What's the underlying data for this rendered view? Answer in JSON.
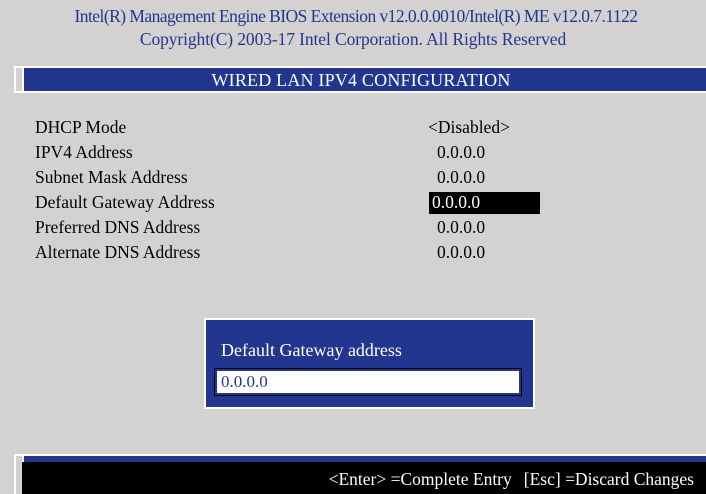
{
  "header": {
    "line1": "Intel(R) Management Engine BIOS Extension v12.0.0.0010/Intel(R) ME v12.0.7.1122",
    "line2": "Copyright(C) 2003-17 Intel Corporation. All Rights Reserved"
  },
  "screen": {
    "title": "WIRED LAN IPV4 CONFIGURATION"
  },
  "settings": [
    {
      "label": "DHCP Mode",
      "value": "<Disabled>"
    },
    {
      "label": "IPV4 Address",
      "value": "0.0.0.0"
    },
    {
      "label": "Subnet Mask Address",
      "value": "0.0.0.0"
    },
    {
      "label": "Default Gateway Address",
      "value": "0.0.0.0",
      "selected": true
    },
    {
      "label": "Preferred DNS Address",
      "value": "0.0.0.0"
    },
    {
      "label": "Alternate DNS Address",
      "value": "0.0.0.0"
    }
  ],
  "dialog": {
    "title": "Default Gateway address",
    "input_value": "0.0.0.0"
  },
  "footer": {
    "enter_hint": "<Enter> =Complete Entry",
    "esc_hint": "[Esc] =Discard Changes"
  },
  "colors": {
    "bios_blue": "#23368f",
    "background": "#d3d2d1",
    "highlight": "#000000"
  }
}
